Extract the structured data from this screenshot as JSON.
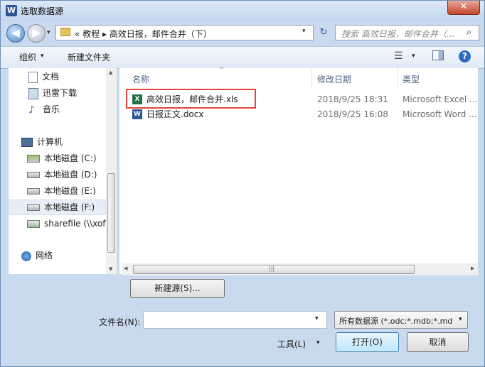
{
  "window": {
    "title": "选取数据源",
    "close_glyph": "✕",
    "title_icon": "W"
  },
  "nav": {
    "back_glyph": "◀",
    "forward_glyph": "▶",
    "recent_glyph": "▾",
    "refresh_glyph": "↻"
  },
  "address": {
    "path": "« 教程 ▸ 高效日报，邮件合并（下）",
    "drop_glyph": "▾"
  },
  "search": {
    "placeholder": "搜索 高效日报，邮件合并（...",
    "icon": "search-icon",
    "icon_glyph": "⌕"
  },
  "toolbar": {
    "organize_label": "组织",
    "organize_drop": "▾",
    "new_folder_label": "新建文件夹",
    "view_glyph": "☰",
    "view_drop": "▾",
    "help_glyph": "?"
  },
  "navpane": {
    "items": [
      {
        "label": "文档"
      },
      {
        "label": "迅雷下载"
      },
      {
        "label": "音乐"
      },
      {
        "label": "计算机"
      },
      {
        "label": "本地磁盘 (C:)"
      },
      {
        "label": "本地磁盘 (D:)"
      },
      {
        "label": "本地磁盘 (E:)"
      },
      {
        "label": "本地磁盘 (F:)"
      },
      {
        "label": "sharefile (\\\\xofi"
      },
      {
        "label": "网络"
      }
    ],
    "sort_glyph": "^"
  },
  "filelist": {
    "headers": {
      "name": "名称",
      "modified": "修改日期",
      "type": "类型"
    },
    "rows": [
      {
        "name": "高效日报，邮件合并.xls",
        "modified": "2018/9/25 18:31",
        "type": "Microsoft Excel ...",
        "icon": "X",
        "icon_color": "#1f7244"
      },
      {
        "name": "日报正文.docx",
        "modified": "2018/9/25 16:08",
        "type": "Microsoft Word ...",
        "icon": "W",
        "icon_color": "#2b5797"
      }
    ]
  },
  "scroll": {
    "up": "▲",
    "down": "▼",
    "left": "◀",
    "right": "▶",
    "grip": "|||"
  },
  "buttons": {
    "new_source": "新建源(S)...",
    "open": "打开(O)",
    "cancel": "取消",
    "tools": "工具(L)",
    "tools_drop": "▾"
  },
  "filename": {
    "label": "文件名(N):",
    "value": "",
    "drop_glyph": "▾"
  },
  "filter": {
    "value": "所有数据源 (*.odc;*.mdb;*.mdb;*.mde;*.accdb",
    "drop_glyph": "▾"
  }
}
